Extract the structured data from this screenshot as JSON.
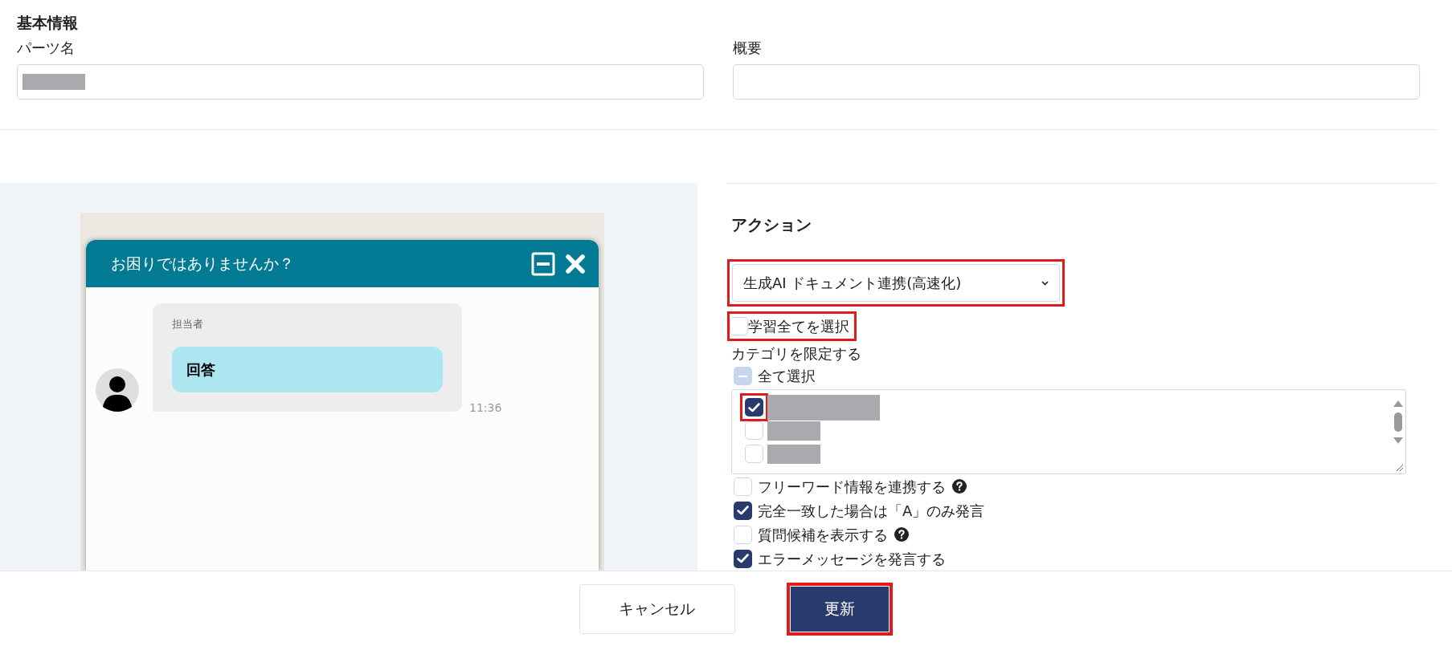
{
  "basic_info": {
    "title": "基本情報",
    "fields": [
      {
        "label": "パーツ名",
        "redacted": true
      },
      {
        "label": "概要",
        "redacted": false
      }
    ]
  },
  "preview": {
    "header_title": "お困りではありませんか？",
    "message": {
      "sender": "担当者",
      "text": "回答",
      "time": "11:36"
    }
  },
  "action": {
    "title": "アクション",
    "select": {
      "value": "生成AI ドキュメント連携(高速化)",
      "highlighted": true
    },
    "learn_all": {
      "label": "学習全てを選択",
      "checked": false,
      "highlighted": true
    },
    "category_label": "カテゴリを限定する",
    "select_all": {
      "label": "全て選択",
      "indeterminate": true
    },
    "categories": [
      {
        "checked": true,
        "highlighted": true,
        "wide": true
      },
      {
        "checked": false,
        "highlighted": false,
        "wide": false
      },
      {
        "checked": false,
        "highlighted": false,
        "wide": false
      }
    ],
    "options": [
      {
        "label": "フリーワード情報を連携する",
        "checked": false,
        "help": true
      },
      {
        "label": "完全一致した場合は「A」のみ発言",
        "checked": true,
        "help": false
      },
      {
        "label": "質問候補を表示する",
        "checked": false,
        "help": true
      },
      {
        "label": "エラーメッセージを発言する",
        "checked": true,
        "help": false
      }
    ]
  },
  "footer": {
    "buttons": [
      {
        "label": "キャンセル",
        "kind": "secondary",
        "highlighted": false
      },
      {
        "label": "更新",
        "kind": "primary",
        "highlighted": true
      }
    ]
  }
}
